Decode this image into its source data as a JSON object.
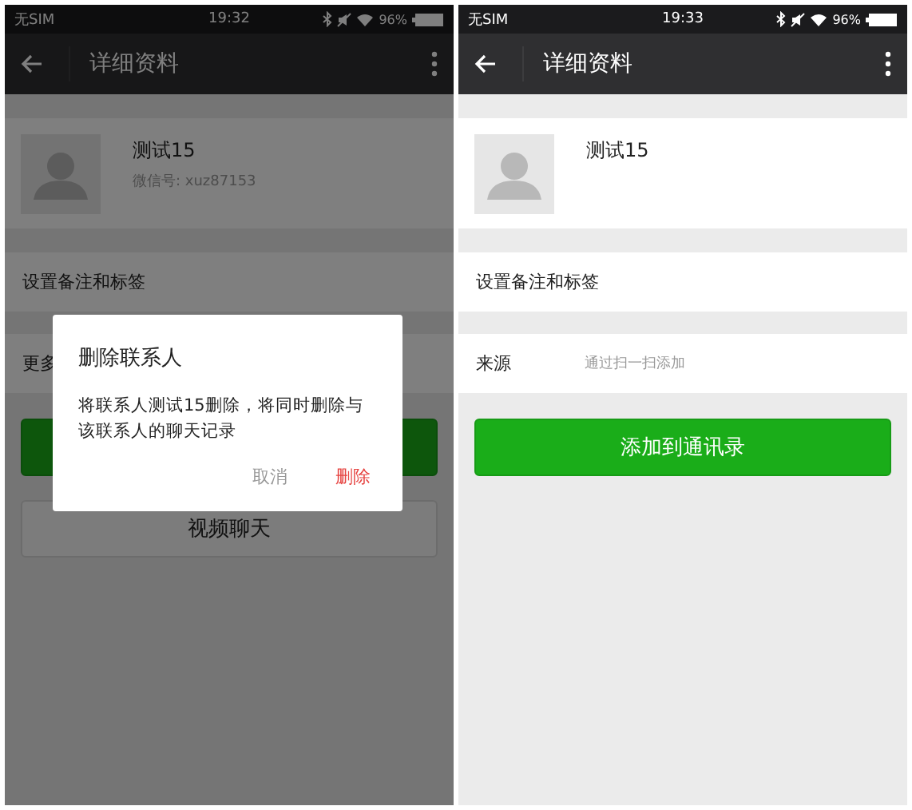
{
  "screens": [
    {
      "status_bar": {
        "carrier": "无SIM",
        "time": "19:32",
        "battery": "96%"
      },
      "title": "详细资料",
      "contact": {
        "name": "测试15",
        "wechat_id": "微信号: xuz87153"
      },
      "rows": [
        {
          "label": "设置备注和标签"
        },
        {
          "label": "更多"
        }
      ],
      "buttons": [
        {
          "kind": "primary"
        },
        {
          "kind": "secondary",
          "label": "视频聊天"
        }
      ],
      "dialog": {
        "title": "删除联系人",
        "message": "将联系人测试15删除，将同时删除与该联系人的聊天记录",
        "actions": [
          {
            "kind": "cancel",
            "label": "取消"
          },
          {
            "kind": "destructive",
            "label": "删除"
          }
        ]
      }
    },
    {
      "status_bar": {
        "carrier": "无SIM",
        "time": "19:33",
        "battery": "96%"
      },
      "title": "详细资料",
      "contact": {
        "name": "测试15"
      },
      "rows": [
        {
          "label": "设置备注和标签"
        },
        {
          "label": "来源",
          "value": "通过扫一扫添加"
        }
      ],
      "buttons": [
        {
          "kind": "primary",
          "label": "添加到通讯录"
        }
      ]
    }
  ]
}
